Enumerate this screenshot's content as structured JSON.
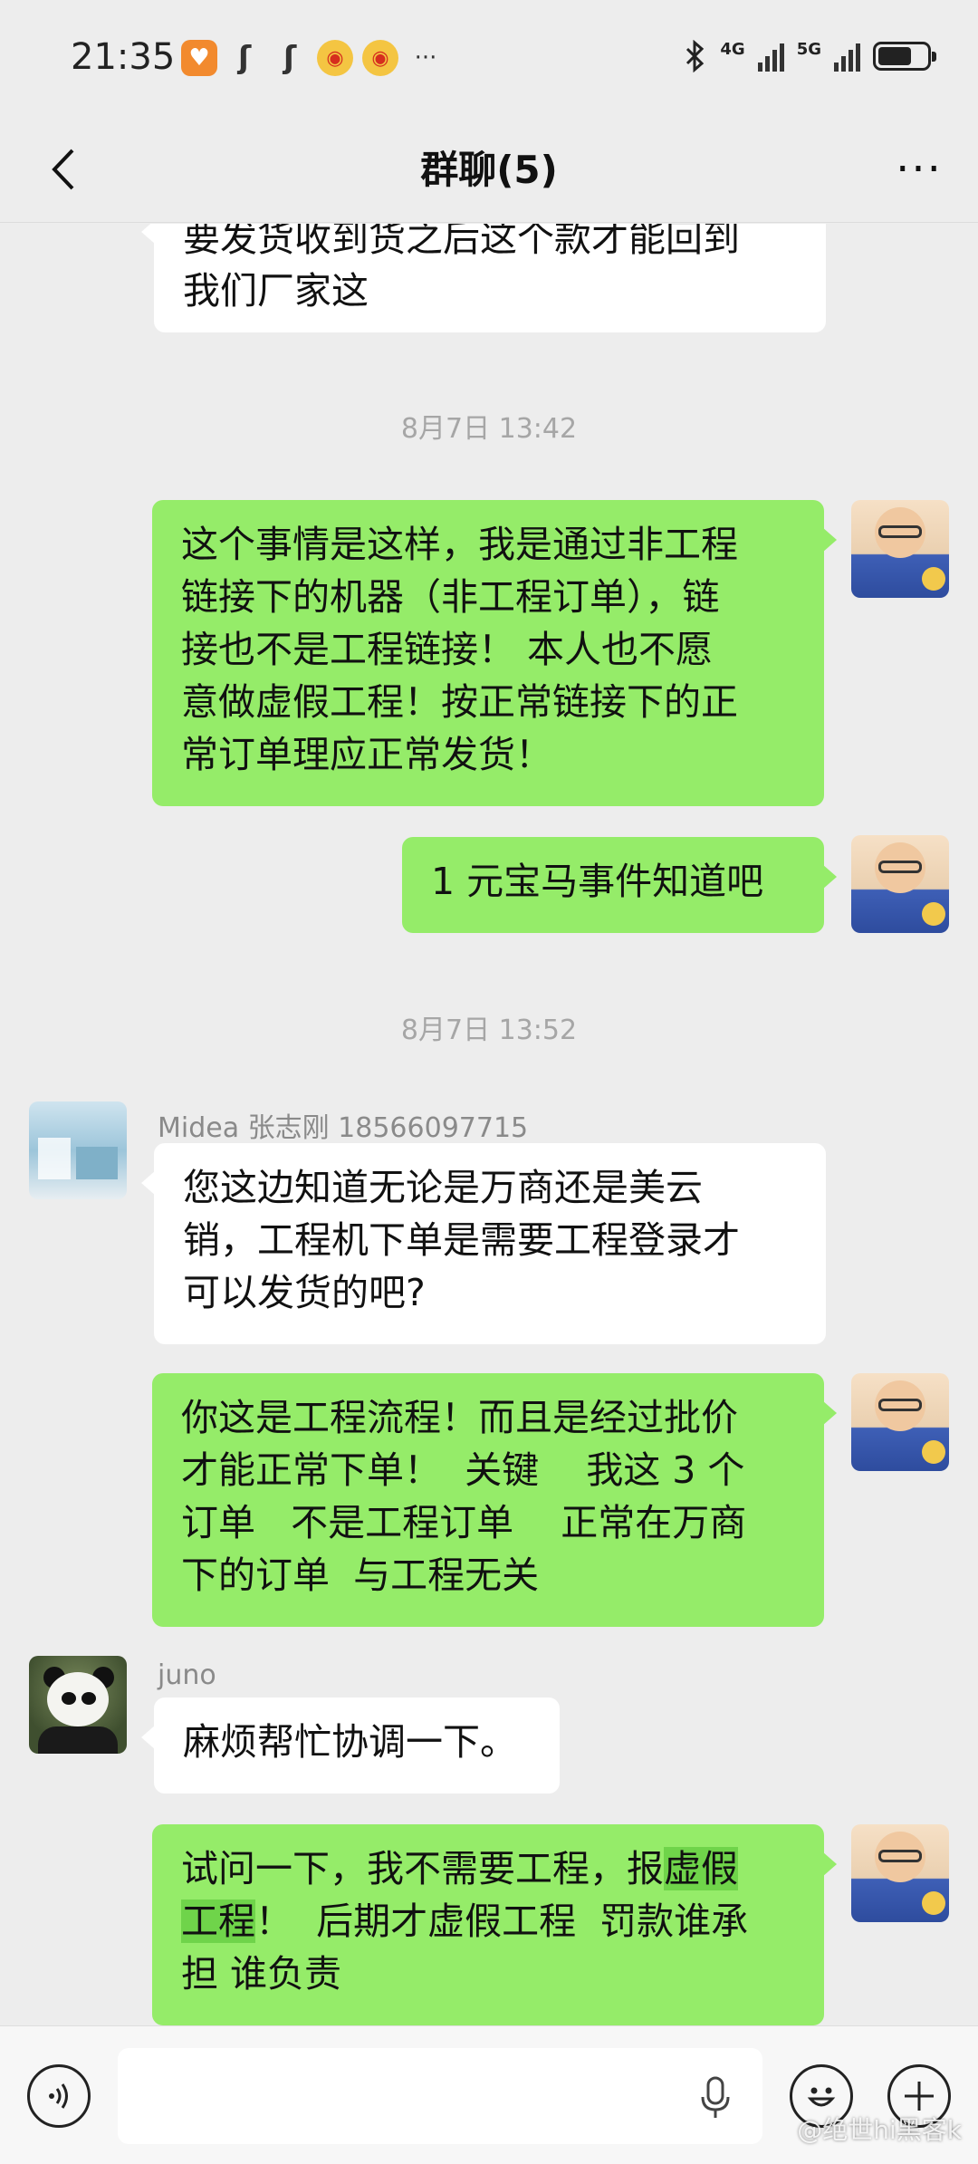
{
  "status_bar": {
    "time": "21:35",
    "net1": "4G",
    "net2": "5G",
    "battery_level": 0.7,
    "more": "···"
  },
  "header": {
    "title": "群聊(5)",
    "more": "···"
  },
  "messages": [
    {
      "type": "in",
      "text": "要发货收到货之后这个款才能回到\n我们厂家这"
    },
    {
      "type": "time",
      "text": "8月7日 13:42"
    },
    {
      "type": "out",
      "text": "这个事情是这样，我是通过非工程\n链接下的机器（非工程订单），链\n接也不是工程链接！ 本人也不愿\n意做虚假工程！按正常链接下的正\n常订单理应正常发货！"
    },
    {
      "type": "out",
      "text": "1 元宝马事件知道吧"
    },
    {
      "type": "time",
      "text": "8月7日 13:52"
    },
    {
      "type": "in",
      "sender": "Midea 张志刚 18566097715",
      "text": "您这边知道无论是万商还是美云\n销，工程机下单是需要工程登录才\n可以发货的吧?"
    },
    {
      "type": "out",
      "text": "你这是工程流程！而且是经过批价\n才能正常下单！  关键    我这 3 个\n订单   不是工程订单    正常在万商\n下的订单  与工程无关"
    },
    {
      "type": "in",
      "sender": "juno",
      "text": "麻烦帮忙协调一下。"
    },
    {
      "type": "out",
      "text_before": "试问一下，我不需要工程，报",
      "text_highlight_1": "虚假",
      "text_highlight_2": "工程",
      "text_after": "！  后期才虚假工程  罚款谁承\n担 谁负责"
    }
  ],
  "input": {
    "placeholder": "",
    "value": ""
  },
  "watermark": "@绝世hi黑客k"
}
